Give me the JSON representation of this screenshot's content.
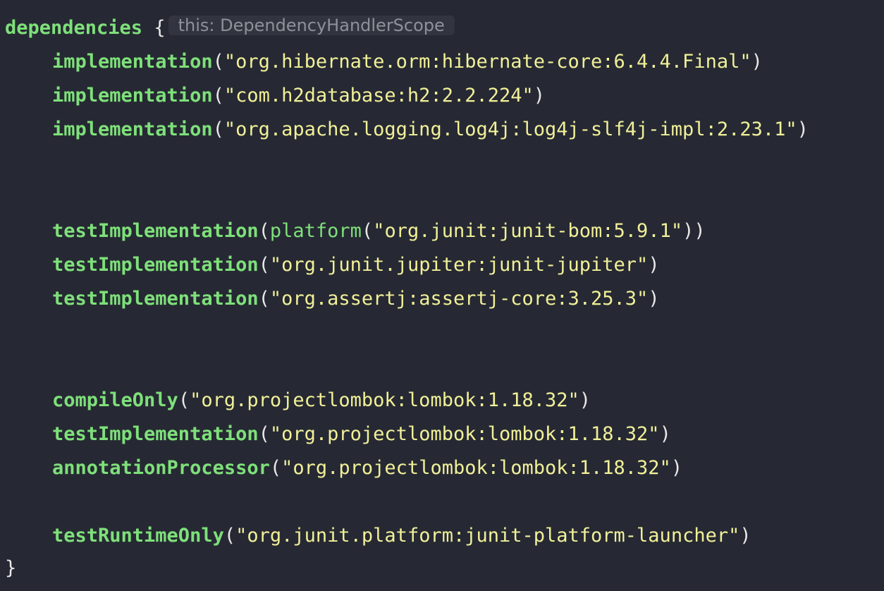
{
  "editor": {
    "block_open": {
      "keyword": "dependencies",
      "brace": "{",
      "hint": "this: DependencyHandlerScope"
    },
    "lines": [
      {
        "fn": "implementation",
        "open": "(",
        "arg": "\"org.hibernate.orm:hibernate-core:6.4.4.Final\"",
        "close": ")"
      },
      {
        "fn": "implementation",
        "open": "(",
        "arg": "\"com.h2database:h2:2.2.224\"",
        "close": ")"
      },
      {
        "fn": "implementation",
        "open": "(",
        "arg": "\"org.apache.logging.log4j:log4j-slf4j-impl:2.23.1\"",
        "close": ")"
      },
      {
        "fn": "testImplementation",
        "open": "(",
        "inner_fn": "platform",
        "inner_open": "(",
        "arg": "\"org.junit:junit-bom:5.9.1\"",
        "close": "))"
      },
      {
        "fn": "testImplementation",
        "open": "(",
        "arg": "\"org.junit.jupiter:junit-jupiter\"",
        "close": ")"
      },
      {
        "fn": "testImplementation",
        "open": "(",
        "arg": "\"org.assertj:assertj-core:3.25.3\"",
        "close": ")"
      },
      {
        "fn": "compileOnly",
        "open": "(",
        "arg": "\"org.projectlombok:lombok:1.18.32\"",
        "close": ")"
      },
      {
        "fn": "testImplementation",
        "open": "(",
        "arg": "\"org.projectlombok:lombok:1.18.32\"",
        "close": ")"
      },
      {
        "fn": "annotationProcessor",
        "open": "(",
        "arg": "\"org.projectlombok:lombok:1.18.32\"",
        "close": ")"
      },
      {
        "fn": "testRuntimeOnly",
        "open": "(",
        "arg": "\"org.junit.platform:junit-platform-launcher\"",
        "close": ")"
      }
    ],
    "block_close": "}"
  },
  "colors": {
    "background": "#262933",
    "keyword": "#7ee07a",
    "string": "#f1f099",
    "punctuation": "#e8e8e8",
    "hint_text": "#8e919a",
    "hint_bg": "#32353f"
  }
}
